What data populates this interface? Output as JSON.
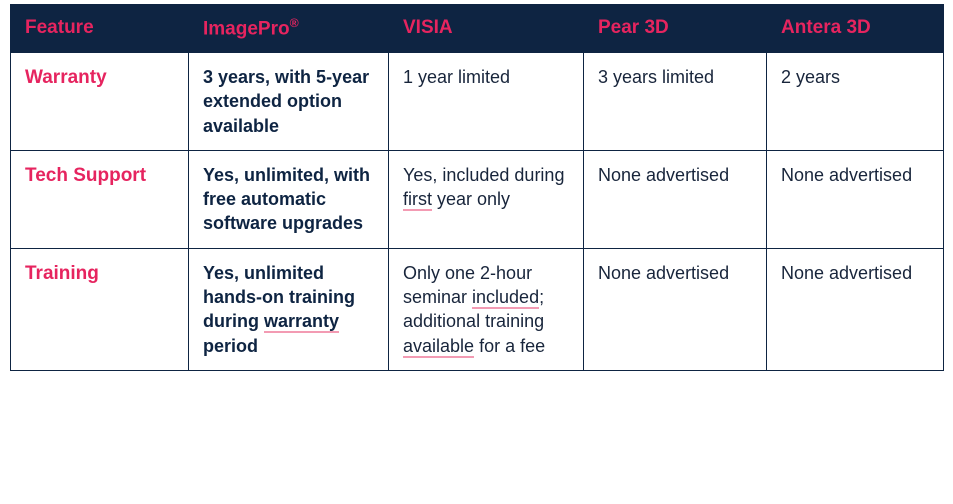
{
  "header": {
    "feature": "Feature",
    "col2_name": "ImagePro",
    "col2_mark": "®",
    "col3": "VISIA",
    "col4": "Pear 3D",
    "col5": "Antera 3D"
  },
  "rows": {
    "warranty": {
      "feature": "Warranty",
      "imagepro": "3 years, with 5-year extended option available",
      "visia": "1 year limited",
      "pear": "3 years limited",
      "antera": "2 years"
    },
    "tech": {
      "feature": "Tech Support",
      "imagepro": "Yes, unlimited, with free automatic software upgrades",
      "visia_a": "Yes, included during ",
      "visia_u1": "first",
      "visia_b": " year only",
      "pear": "None advertised",
      "antera": "None advertised"
    },
    "training": {
      "feature": "Training",
      "imagepro_a": "Yes, unlimited hands-on training during ",
      "imagepro_u1": "warranty",
      "imagepro_b": " period",
      "visia_a": "Only one 2-hour seminar ",
      "visia_u1": "included",
      "visia_b": "; additional training ",
      "visia_u2": "available",
      "visia_c": " for a fee",
      "pear": "None advertised",
      "antera": "None advertised"
    }
  },
  "chart_data": {
    "type": "table",
    "columns": [
      "Feature",
      "ImagePro®",
      "VISIA",
      "Pear 3D",
      "Antera 3D"
    ],
    "rows": [
      [
        "Warranty",
        "3 years, with 5-year extended option available",
        "1 year limited",
        "3 years limited",
        "2 years"
      ],
      [
        "Tech Support",
        "Yes, unlimited, with free automatic software upgrades",
        "Yes, included during first year only",
        "None advertised",
        "None advertised"
      ],
      [
        "Training",
        "Yes, unlimited hands-on training during warranty period",
        "Only one 2-hour seminar included; additional training available for a fee",
        "None advertised",
        "None advertised"
      ]
    ]
  }
}
